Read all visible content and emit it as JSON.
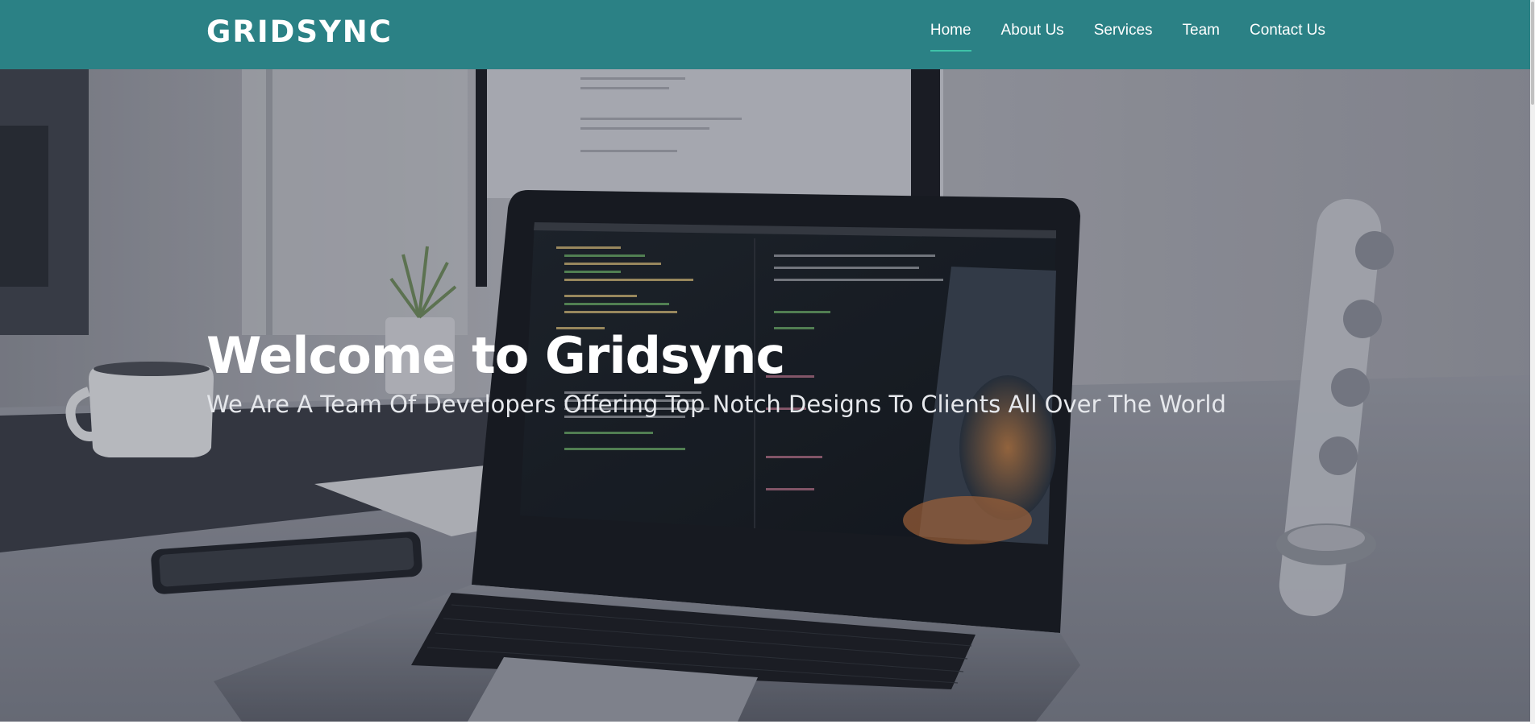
{
  "navbar": {
    "brand": "GRIDSYNC",
    "items": [
      {
        "label": "Home",
        "active": true
      },
      {
        "label": "About Us",
        "active": false
      },
      {
        "label": "Services",
        "active": false
      },
      {
        "label": "Team",
        "active": false
      },
      {
        "label": "Contact Us",
        "active": false
      }
    ]
  },
  "hero": {
    "title": "Welcome to Gridsync",
    "subtitle": "We Are A Team Of Developers Offering Top Notch Designs To Clients All Over The World"
  },
  "colors": {
    "navbar_bg": "#2b8185",
    "active_underline": "#3ec3a8",
    "text": "#ffffff"
  }
}
